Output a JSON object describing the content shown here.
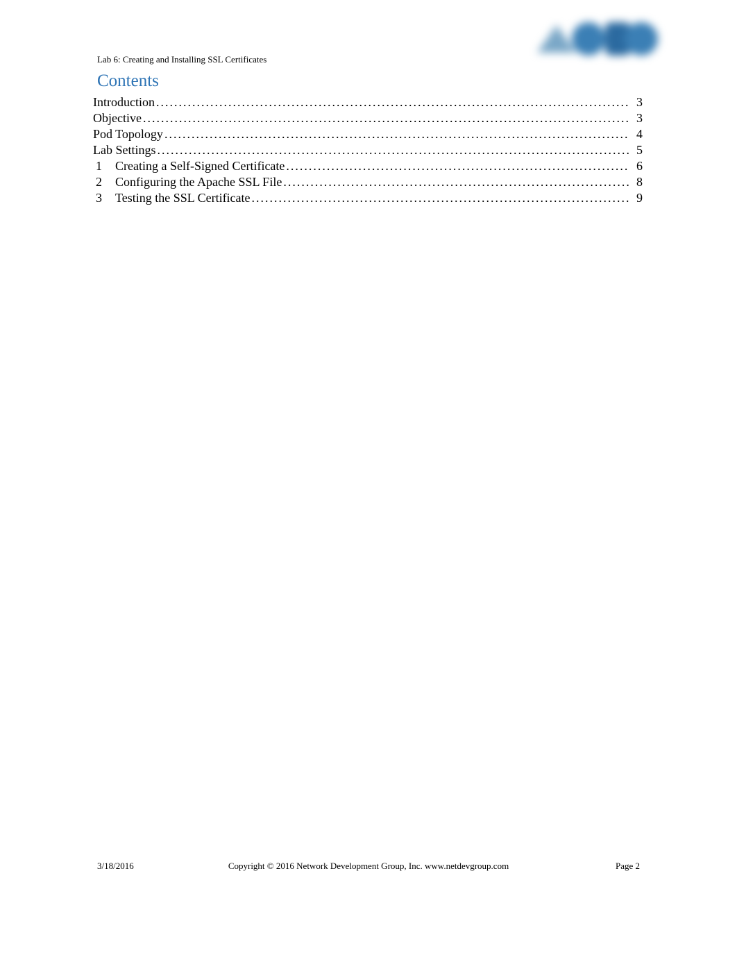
{
  "header": {
    "label": "Lab 6: Creating and Installing SSL Certificates"
  },
  "contents_heading": "Contents",
  "toc": [
    {
      "num": "",
      "title": "Introduction ",
      "page": "3"
    },
    {
      "num": "",
      "title": "Objective ",
      "page": "3"
    },
    {
      "num": "",
      "title": "Pod Topology ",
      "page": "4"
    },
    {
      "num": "",
      "title": "Lab Settings",
      "page": "5"
    },
    {
      "num": "1",
      "title": "Creating a Self-Signed Certificate",
      "page": "6"
    },
    {
      "num": "2",
      "title": "Configuring the Apache SSL File",
      "page": "8"
    },
    {
      "num": "3",
      "title": "Testing the SSL Certificate",
      "page": "9"
    }
  ],
  "footer": {
    "date": "3/18/2016",
    "copyright": "Copyright © 2016 Network Development Group, Inc.  www.netdevgroup.com",
    "page_label": "Page 2"
  }
}
